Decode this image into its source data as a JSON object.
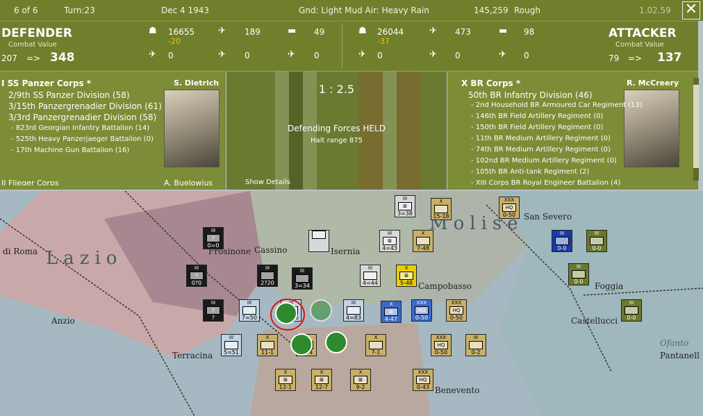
{
  "topbar": {
    "turn_of": "6 of 6",
    "turn": "Turn:23",
    "date": "Dec 4 1943",
    "weather": "Gnd: Light Mud  Air: Heavy Rain",
    "location_id": "145,259",
    "terrain": "Rough",
    "version": "1.02.59",
    "close_label": "✕"
  },
  "defender": {
    "label": "DEFENDER",
    "cv_label": "Combat Value",
    "cv_start": "207",
    "arrow": "=>",
    "cv_end": "348",
    "men": "16655",
    "men_loss": "-20",
    "guns": "189",
    "tanks": "49",
    "fighters": "0",
    "bombers": "0",
    "transports": "0"
  },
  "attacker": {
    "label": "ATTACKER",
    "cv_label": "Combat Value",
    "cv_start": "79",
    "arrow": "=>",
    "cv_end": "137",
    "men": "26044",
    "men_loss": "-37",
    "guns": "473",
    "tanks": "98",
    "fighters": "0",
    "bombers": "0",
    "transports": "0"
  },
  "def_panel": {
    "corps": "I SS Panzer Corps *",
    "commander": "S. Dietrich",
    "units": [
      "2/9th SS Panzer Division (58)",
      "3/15th Panzergrenadier Division (61)",
      "3/3rd Panzergrenadier Division (58)"
    ],
    "subunits": [
      "- 823rd Georgian Infantry Battalion (14)",
      "- 525th Heavy Panzerjaeger Battalion (0)",
      "- 17th Machine Gun Battalion (16)"
    ],
    "next_corps": "II Flieger Corps",
    "next_commander": "A. Buelowius"
  },
  "center": {
    "odds": "1 : 2.5",
    "result": "Defending Forces HELD",
    "halt": "Halt range 875",
    "details": "Show Details"
  },
  "att_panel": {
    "corps": "X BR Corps *",
    "commander": "R. McCreery",
    "division": "50th BR Infantry Division (46)",
    "subunits": [
      "- 2nd Household BR Armoured Car Regiment (13)",
      "- 146th BR Field Artillery Regiment (0)",
      "- 150th BR Field Artillery Regiment (0)",
      "- 11th BR Medium Artillery Regiment (0)",
      "- 74th BR Medium Artillery Regiment (0)",
      "- 102nd BR Medium Artillery Regiment (0)",
      "- 105th BR Anti-tank Regiment (2)",
      "- XIII Corps BR Royal Engineer Battalion (4)"
    ]
  },
  "map": {
    "places": [
      "di Roma",
      "Lazio",
      "Frosinone",
      "Cassino",
      "Isernia",
      "Molise",
      "Campobasso",
      "San Severo",
      "Foggia",
      "Anzio",
      "Terracina",
      "Castellucci",
      "Benevento",
      "Ofanto",
      "Pantanell"
    ],
    "units": [
      {
        "lvl": "III",
        "sym": "?",
        "val": "0=0",
        "bg": "#1a1a1a"
      },
      {
        "lvl": "III",
        "sym": "?",
        "val": "0?0",
        "bg": "#1a1a1a"
      },
      {
        "lvl": "III",
        "sym": "?",
        "val": "?",
        "bg": "#1a1a1a"
      },
      {
        "lvl": "III",
        "sym": "",
        "val": "2?20",
        "bg": "#1a1a1a"
      },
      {
        "lvl": "III",
        "sym": "",
        "val": "3=34",
        "bg": "#1a1a1a"
      },
      {
        "lvl": "",
        "sym": "",
        "val": "",
        "bg": "#d8d8d8"
      },
      {
        "lvl": "III",
        "sym": "⊠",
        "val": "3=38",
        "bg": "#d8d8d8"
      },
      {
        "lvl": "III",
        "sym": "⊠",
        "val": "4=43",
        "bg": "#d8d8d8"
      },
      {
        "lvl": "III",
        "sym": "",
        "val": "4=44",
        "bg": "#d8d8d8"
      },
      {
        "lvl": "III",
        "sym": "",
        "val": "7=50",
        "bg": "#c4d4e4"
      },
      {
        "lvl": "III",
        "sym": "",
        "val": "4=83",
        "bg": "#c4d4e4"
      },
      {
        "lvl": "III",
        "sym": "",
        "val": "5=51",
        "bg": "#c4d4e4"
      },
      {
        "lvl": "III",
        "sym": "",
        "val": "1=16",
        "bg": "#c4d4e4"
      },
      {
        "lvl": "X",
        "sym": "",
        "val": "15-18",
        "bg": "#c8b068"
      },
      {
        "lvl": "X",
        "sym": "",
        "val": "7-48",
        "bg": "#c8b068"
      },
      {
        "lvl": "X",
        "sym": "⊠",
        "val": "5-48",
        "bg": "#e8d000"
      },
      {
        "lvl": "X",
        "sym": "⊠",
        "val": "4-47",
        "bg": "#3a6ac8"
      },
      {
        "lvl": "XXX",
        "sym": "HQ",
        "val": "0-50",
        "bg": "#3a6ac8"
      },
      {
        "lvl": "XXX",
        "sym": "HQ",
        "val": "0-50",
        "bg": "#c8b068"
      },
      {
        "lvl": "XXX",
        "sym": "HQ",
        "val": "0-50",
        "bg": "#c8b068"
      },
      {
        "lvl": "XXX",
        "sym": "HQ",
        "val": "0-50",
        "bg": "#c8b068"
      },
      {
        "lvl": "III",
        "sym": "",
        "val": "0-2",
        "bg": "#c8b068"
      },
      {
        "lvl": "X",
        "sym": "",
        "val": "11-1",
        "bg": "#c8b068"
      },
      {
        "lvl": "X",
        "sym": "",
        "val": "11-4",
        "bg": "#c8b068"
      },
      {
        "lvl": "X",
        "sym": "",
        "val": "7-1",
        "bg": "#c8b068"
      },
      {
        "lvl": "X",
        "sym": "⊠",
        "val": "12-1",
        "bg": "#c8b068"
      },
      {
        "lvl": "X",
        "sym": "⊠",
        "val": "12-7",
        "bg": "#c8b068"
      },
      {
        "lvl": "X",
        "sym": "⊠",
        "val": "9-2",
        "bg": "#c8b068"
      },
      {
        "lvl": "XXX",
        "sym": "HQ",
        "val": "0-43",
        "bg": "#c8b068"
      },
      {
        "lvl": "III",
        "sym": "",
        "val": "0-0",
        "bg": "#1a3aa8"
      },
      {
        "lvl": "III",
        "sym": "",
        "val": "0-0",
        "bg": "#6a7a2a"
      },
      {
        "lvl": "III",
        "sym": "",
        "val": "0-0",
        "bg": "#6a7a2a"
      },
      {
        "lvl": "III",
        "sym": "",
        "val": "0-0",
        "bg": "#6a7a2a"
      }
    ]
  }
}
